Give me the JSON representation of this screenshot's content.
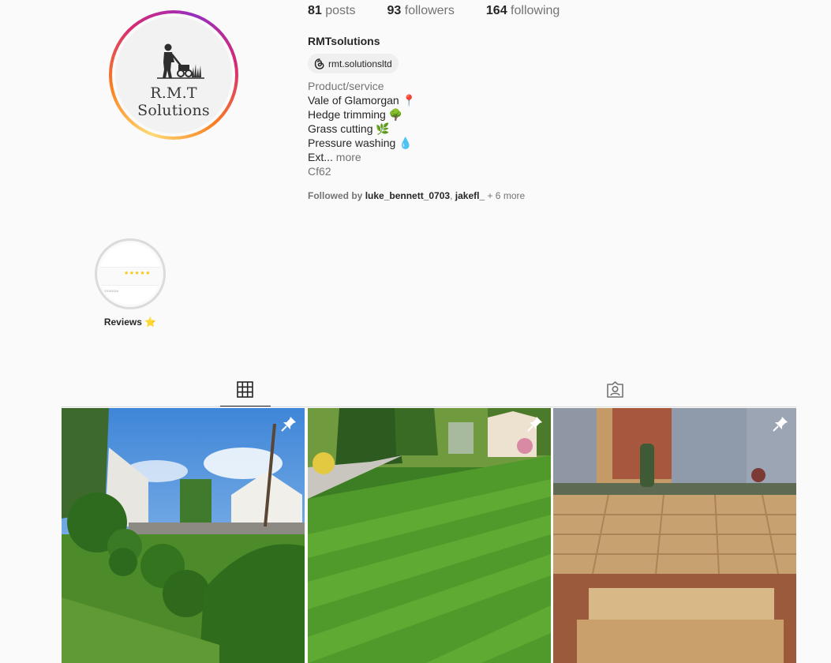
{
  "profile": {
    "username": "RMTsolutions",
    "avatar_text": "R.M.T Solutions",
    "threads_handle": "rmt.solutionsltd",
    "stats": {
      "posts_count": "81",
      "posts_label": "posts",
      "followers_count": "93",
      "followers_label": "followers",
      "following_count": "164",
      "following_label": "following"
    },
    "bio": {
      "category": "Product/service",
      "lines": [
        "Vale of Glamorgan 📍",
        "Hedge trimming 🌳",
        "Grass cutting 🌿",
        "Pressure washing 💧"
      ],
      "truncated": "Ext...",
      "more": "more",
      "location": "Cf62"
    },
    "followed_by": {
      "prefix": "Followed by",
      "user1": "luke_bennett_0703",
      "separator": ",",
      "user2": "jakefl_",
      "more": "+ 6 more"
    }
  },
  "highlights": [
    {
      "label": "Reviews ⭐",
      "thumb_date": "16/10/2024",
      "thumb_stars": "★★★★★"
    }
  ],
  "tabs": [
    {
      "name": "posts-grid",
      "icon": "grid-icon",
      "active": true
    },
    {
      "name": "tagged",
      "icon": "tagged-icon",
      "active": false
    }
  ],
  "posts": [
    {
      "subject": "trimmed hedges",
      "pinned": true
    },
    {
      "subject": "striped lawn",
      "pinned": true
    },
    {
      "subject": "sandstone patio",
      "pinned": true
    }
  ],
  "colors": {
    "text": "#262626",
    "secondary": "#737373",
    "background": "#fafafa"
  }
}
